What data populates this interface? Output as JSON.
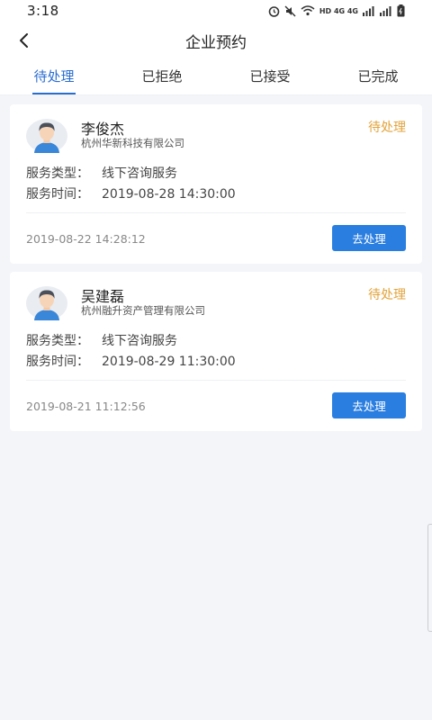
{
  "status_bar": {
    "time": "3:18",
    "network": "HD 4G 4G",
    "icons": [
      "alarm-icon",
      "mute-icon",
      "wifi-icon",
      "signal-icon",
      "signal-icon",
      "battery-icon"
    ]
  },
  "header": {
    "back_icon": "chevron-left-icon",
    "title": "企业预约"
  },
  "tabs": [
    {
      "label": "待处理",
      "active": true
    },
    {
      "label": "已拒绝",
      "active": false
    },
    {
      "label": "已接受",
      "active": false
    },
    {
      "label": "已完成",
      "active": false
    }
  ],
  "colors": {
    "accent": "#2a6dd1",
    "button": "#2a7ee0",
    "pending": "#e2a33a",
    "background": "#f4f5f8"
  },
  "appointments": [
    {
      "name": "李俊杰",
      "company": "杭州华新科技有限公司",
      "status": "待处理",
      "service_type_label": "服务类型：",
      "service_type": "线下咨询服务",
      "service_time_label": "服务时间：",
      "service_time": "2019-08-28 14:30:00",
      "created_at": "2019-08-22 14:28:12",
      "action": "去处理"
    },
    {
      "name": "吴建磊",
      "company": "杭州融升资产管理有限公司",
      "status": "待处理",
      "service_type_label": "服务类型：",
      "service_type": "线下咨询服务",
      "service_time_label": "服务时间：",
      "service_time": "2019-08-29 11:30:00",
      "created_at": "2019-08-21 11:12:56",
      "action": "去处理"
    }
  ]
}
